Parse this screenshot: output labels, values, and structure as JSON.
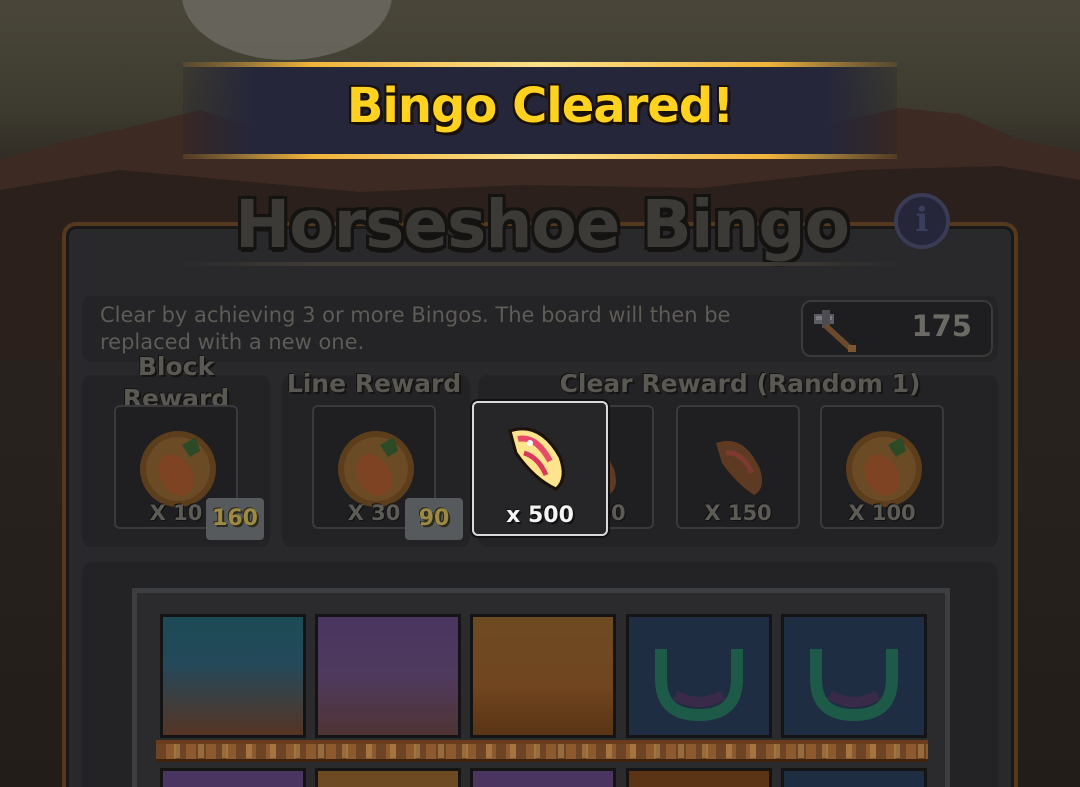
{
  "banner": {
    "text": "Bingo Cleared!"
  },
  "title": "Horseshoe Bingo",
  "info_button": {
    "icon": "info-icon",
    "glyph": "i"
  },
  "description": "Clear by achieving 3 or more Bingos. The board will then be replaced with a new one.",
  "currency": {
    "icon": "hammer-icon",
    "value": "175"
  },
  "sections": {
    "block": {
      "label": "Block Reward",
      "qty": "X 10",
      "cost": "160",
      "item": "carrot-plate-icon"
    },
    "line": {
      "label": "Line Reward",
      "qty": "X 30",
      "cost": "90",
      "item": "carrot-plate-icon"
    },
    "clear": {
      "label": "Clear Reward (Random 1)",
      "items": [
        {
          "item": "meat-icon",
          "qty": "X 500"
        },
        {
          "item": "meat-icon",
          "qty": "X 150"
        },
        {
          "item": "carrot-plate-icon",
          "qty": "X 100"
        }
      ],
      "selected": {
        "item": "meat-icon",
        "qty": "x 500"
      }
    }
  },
  "board": {
    "tiles": [
      "teal-tile",
      "purple-tile",
      "orange-tile",
      "horseshoe-tile",
      "horseshoe-tile"
    ]
  },
  "colors": {
    "banner_text": "#ffd21f",
    "banner_gold": "#f0b43a",
    "panel_border": "#54391f"
  }
}
